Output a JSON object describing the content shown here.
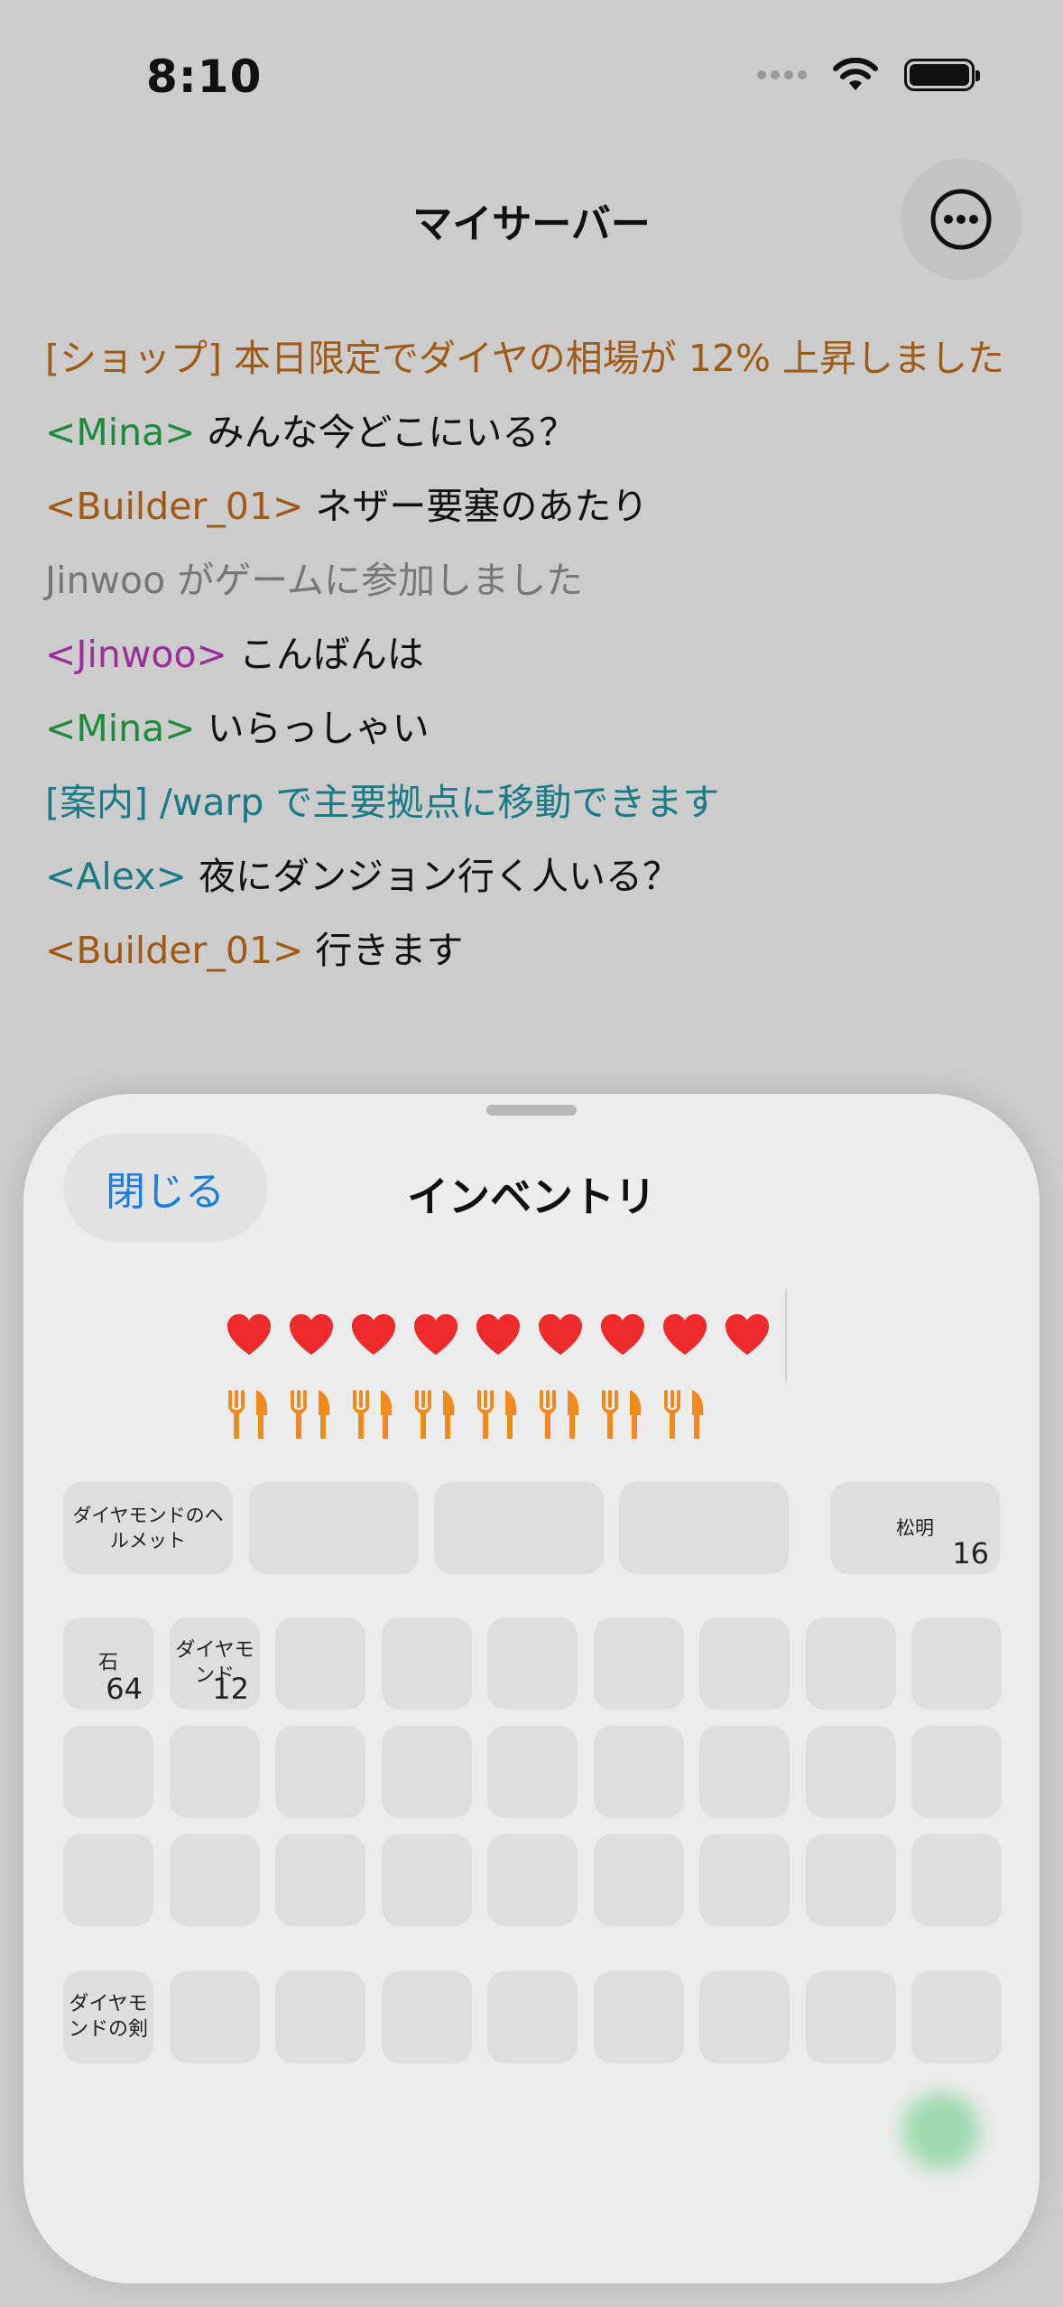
{
  "status_bar": {
    "time": "8:10"
  },
  "nav": {
    "title": "マイサーバー",
    "more_icon": "ellipsis-circle-icon"
  },
  "chat": [
    {
      "sender": "",
      "text": "[ショップ] 本日限定でダイヤの相場が 12% 上昇しました",
      "color": "#a05a14"
    },
    {
      "sender": "<Mina>",
      "text": " みんな今どこにいる？",
      "color": "#1f8a3b"
    },
    {
      "sender": "<Builder_01>",
      "text": " ネザー要塞のあたり",
      "color": "#a05a14"
    },
    {
      "sender": "",
      "text": "Jinwoo がゲームに参加しました",
      "color": "#777777"
    },
    {
      "sender": "<Jinwoo>",
      "text": " こんばんは",
      "color": "#9a2e9a"
    },
    {
      "sender": "<Mina>",
      "text": " いらっしゃい",
      "color": "#1f8a3b"
    },
    {
      "sender": "",
      "text": "[案内] /warp で主要拠点に移動できます",
      "color": "#1a7a86"
    },
    {
      "sender": "<Alex>",
      "text": " 夜にダンジョン行く人いる？",
      "color": "#1a7a86"
    },
    {
      "sender": "<Builder_01>",
      "text": " 行きます",
      "color": "#a05a14"
    }
  ],
  "sheet": {
    "close_label": "閉じる",
    "title": "インベントリ",
    "hearts": 9,
    "food": 8,
    "armor_slots": [
      {
        "label": "ダイヤモンドのヘルメット",
        "count": ""
      },
      {
        "label": "",
        "count": ""
      },
      {
        "label": "",
        "count": ""
      },
      {
        "label": "",
        "count": ""
      }
    ],
    "offhand": {
      "label": "松明",
      "count": "16"
    },
    "inventory_row1": [
      {
        "label": "石",
        "count": "64"
      },
      {
        "label": "ダイヤモンド",
        "count": "12"
      }
    ],
    "hotbar_first": {
      "label": "ダイヤモンドの剣",
      "count": ""
    }
  },
  "colors": {
    "heart": "#ee2a2a",
    "food": "#f08a1c",
    "accent": "#1a7ee0"
  }
}
